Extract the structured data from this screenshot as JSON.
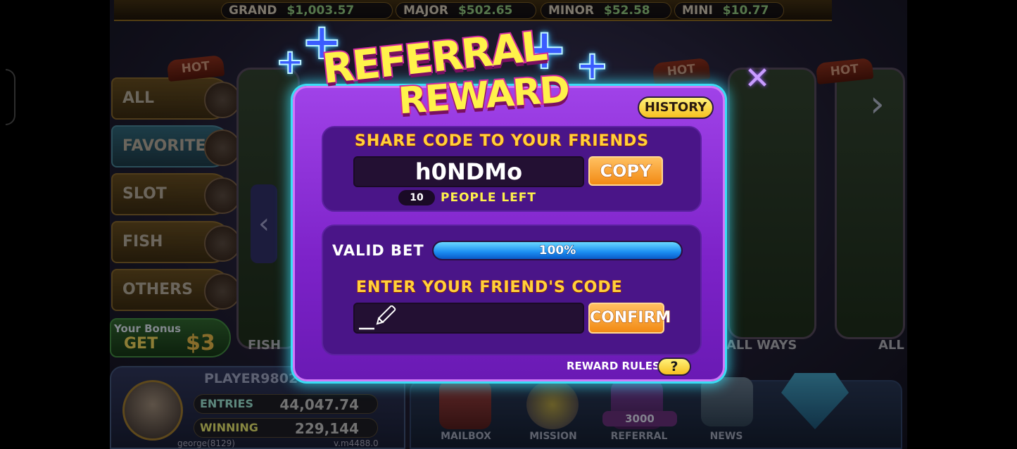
{
  "jackpots": [
    {
      "label": "GRAND",
      "value": "$1,003.57"
    },
    {
      "label": "MAJOR",
      "value": "$502.65"
    },
    {
      "label": "MINOR",
      "value": "$52.58"
    },
    {
      "label": "MINI",
      "value": "$10.77"
    }
  ],
  "categories": [
    {
      "label": "ALL",
      "icon": "all-icon"
    },
    {
      "label": "FAVORITE",
      "icon": "heart-icon"
    },
    {
      "label": "SLOT",
      "icon": "slot-icon"
    },
    {
      "label": "FISH",
      "icon": "fish-icon"
    },
    {
      "label": "OTHERS",
      "icon": "cards-icon"
    }
  ],
  "bonus": {
    "line1": "Your Bonus",
    "line2": "GET",
    "amount": "$3"
  },
  "game_cards": {
    "hot_badge": "HOT",
    "card1_label": "FISH",
    "card2_label": "ALL WAYS",
    "card3_label": "ALL"
  },
  "player": {
    "name": "PLAYER9802",
    "entries_label": "ENTRIES",
    "entries_value": "44,047.74",
    "winning_label": "WINNING",
    "winning_value": "229,144",
    "username": "george(8129)",
    "version": "v.m4488.0"
  },
  "nav": {
    "mailbox": "MAILBOX",
    "mission": "MISSION",
    "referral": "REFERRAL",
    "referral_badge": "3000",
    "news": "NEWS"
  },
  "popup": {
    "title_line1": "REFERRAL",
    "title_line2": "REWARD",
    "history_label": "HISTORY",
    "share_header": "SHARE CODE TO YOUR FRIENDS",
    "code": "h0NDMo",
    "copy_label": "COPY",
    "people_count": "10",
    "people_label": "PEOPLE LEFT",
    "valid_bet_label": "VALID BET",
    "valid_bet_percent": 100,
    "valid_bet_text": "100%",
    "enter_header": "ENTER YOUR FRIEND'S CODE",
    "input_value": "",
    "confirm_label": "CONFIRM",
    "rules_label": "REWARD RULES",
    "help_label": "?"
  },
  "colors": {
    "popup_purple": "#8a2ed8",
    "neon_cyan": "#3adcf4",
    "title_yellow": "#fff24a",
    "header_gold": "#ffd13a",
    "button_orange": "#f28a14",
    "progress_blue": "#1a8cf0"
  }
}
